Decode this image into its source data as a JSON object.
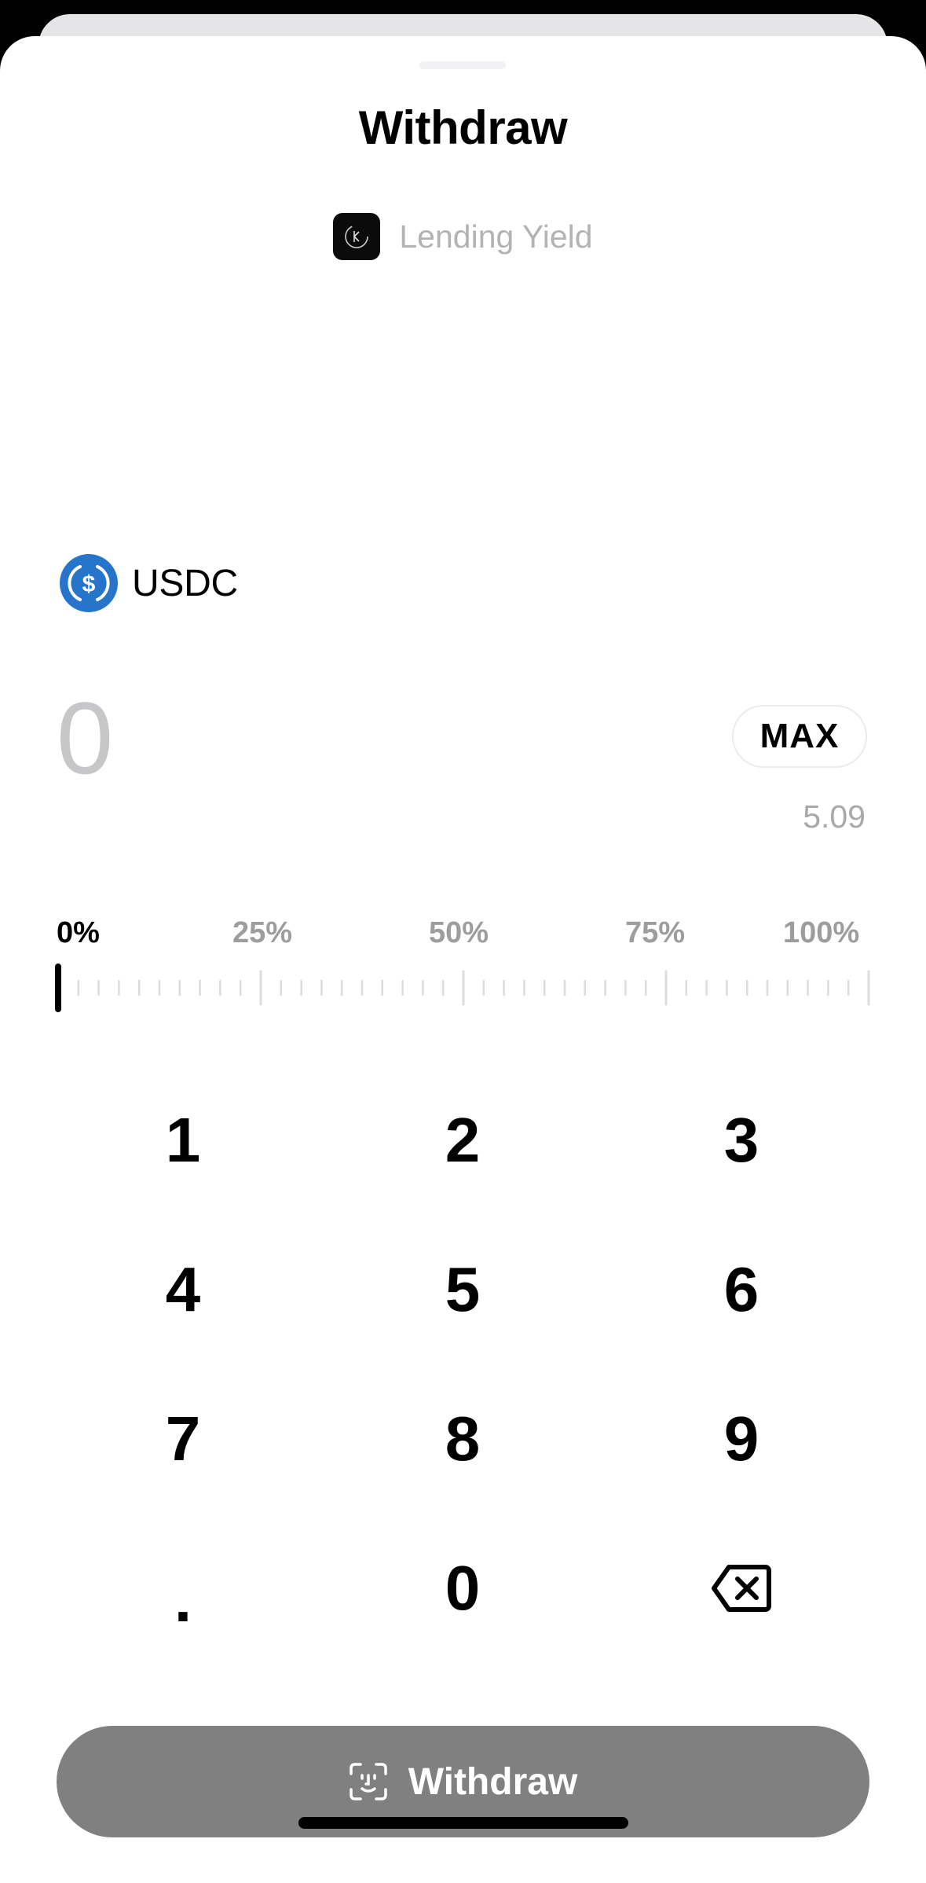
{
  "sheet": {
    "title": "Withdraw",
    "source_label": "Lending Yield",
    "source_logo_icon": "kamino-logo"
  },
  "token": {
    "symbol": "USDC",
    "icon": "usdc-icon",
    "icon_color": "#2775ca"
  },
  "amount": {
    "value": "0",
    "max_label": "MAX",
    "balance": "5.09"
  },
  "slider": {
    "labels": [
      "0%",
      "25%",
      "50%",
      "75%",
      "100%"
    ],
    "selected_percent": 0
  },
  "keypad": {
    "keys": [
      "1",
      "2",
      "3",
      "4",
      "5",
      "6",
      "7",
      "8",
      "9",
      ".",
      "0"
    ],
    "backspace_icon": "backspace-icon"
  },
  "action": {
    "label": "Withdraw",
    "icon": "face-id-icon",
    "button_color": "#808080"
  }
}
